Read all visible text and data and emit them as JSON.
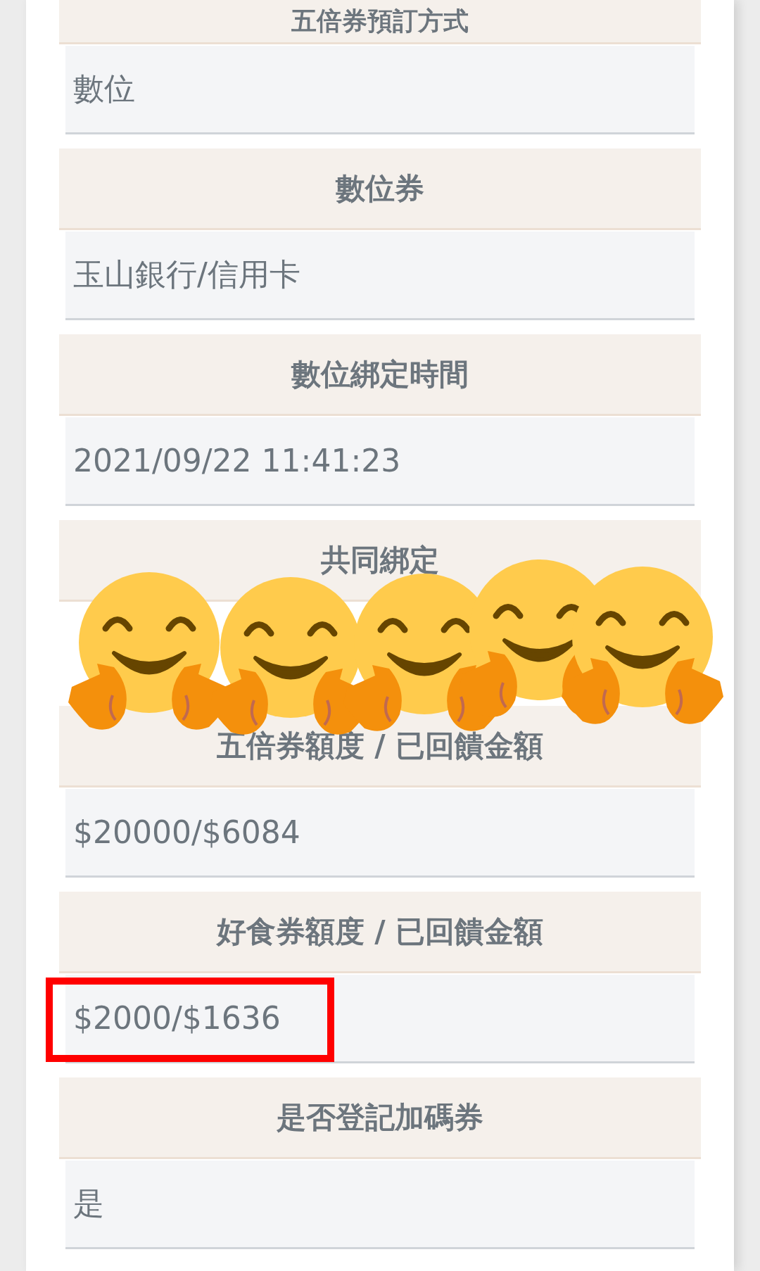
{
  "fields": [
    {
      "label": "五倍券預訂方式",
      "value": "數位",
      "highlighted": false
    },
    {
      "label": "數位券",
      "value": "玉山銀行/信用卡",
      "highlighted": false
    },
    {
      "label": "數位綁定時間",
      "value": "2021/09/22 11:41:23",
      "highlighted": false
    },
    {
      "label": "共同綁定"
    },
    {
      "label": "五倍券額度 / 已回饋金額",
      "value": "$20000/$6084",
      "highlighted": false
    },
    {
      "label": "好食券額度 / 已回饋金額",
      "value": "$2000/$1636",
      "highlighted": true
    },
    {
      "label": "是否登記加碼券",
      "value": "是",
      "highlighted": false
    }
  ]
}
